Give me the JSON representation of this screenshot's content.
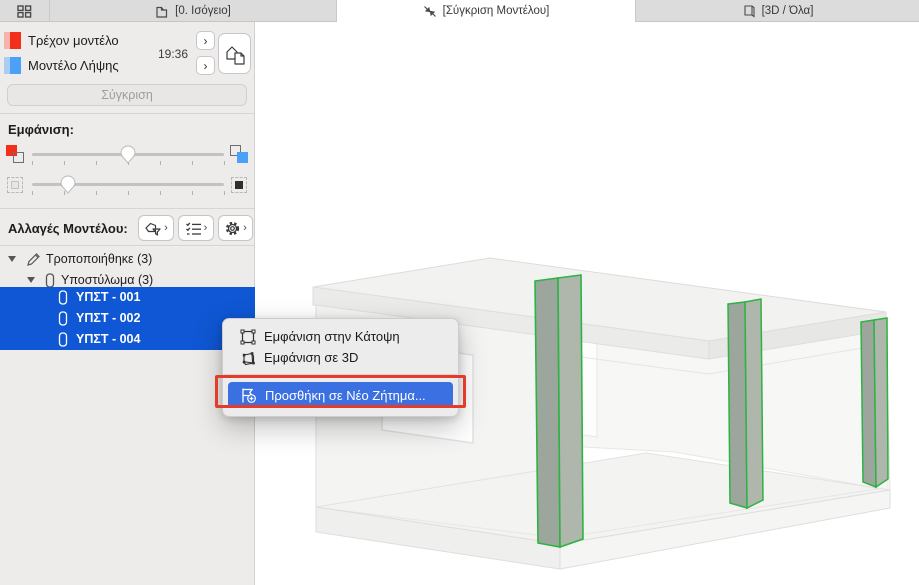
{
  "header": {
    "tabs": [
      {
        "label": "[0. Ισόγειο]",
        "icon": "floor-plan-icon",
        "active": false
      },
      {
        "label": "[Σύγκριση Μοντέλου]",
        "icon": "compare-arrows-icon",
        "active": true
      },
      {
        "label": "[3D / Όλα]",
        "icon": "cube-icon",
        "active": false
      }
    ]
  },
  "sidebar": {
    "models": [
      {
        "label": "Τρέχον μοντέλο",
        "color": "#f3301b",
        "color_light": "#f5b3ab"
      },
      {
        "label": "Μοντέλο Λήψης",
        "color": "#4ba1f7",
        "color_light": "#a9cdf3"
      }
    ],
    "timestamp": "19:36",
    "compare_button_label": "Σύγκριση",
    "display_section_label": "Εμφάνιση:",
    "sliders": [
      {
        "name": "model-color-intensity",
        "value_percent": 50
      },
      {
        "name": "unchanged-elements-visibility",
        "value_percent": 19
      }
    ],
    "changes_section_label": "Αλλαγές Μοντέλου:",
    "tool_buttons": [
      {
        "icon": "filter-model-icon"
      },
      {
        "icon": "checklist-icon"
      },
      {
        "icon": "gear-icon"
      }
    ],
    "tree": [
      {
        "label": "Τροποποιήθηκε (3)",
        "level": 0,
        "icon": "pencil-icon",
        "expanded": true,
        "selected": false
      },
      {
        "label": "Υποστύλωμα (3)",
        "level": 1,
        "icon": "column-icon",
        "expanded": true,
        "selected": false
      },
      {
        "label": "ΥΠΣΤ - 001",
        "level": 2,
        "icon": "column-icon",
        "selected": true
      },
      {
        "label": "ΥΠΣΤ - 002",
        "level": 2,
        "icon": "column-icon",
        "selected": true
      },
      {
        "label": "ΥΠΣΤ - 004",
        "level": 2,
        "icon": "column-icon",
        "selected": true
      }
    ]
  },
  "context_menu": {
    "items": [
      {
        "label": "Εμφάνιση στην Κάτοψη",
        "icon": "marquee-icon",
        "highlighted": false
      },
      {
        "label": "Εμφάνιση σε 3D",
        "icon": "cube-marquee-icon",
        "highlighted": false
      },
      {
        "label": "Προσθήκη σε Νέο Ζήτημα...",
        "icon": "issue-add-icon",
        "highlighted": true
      }
    ],
    "highlight_color": "#3b70e2",
    "annotation_color": "#e43b2a"
  },
  "canvas_3d": {
    "highlighted_column_count": 3,
    "highlight_color": "#2cb442",
    "selection_blue": "#0f57d4"
  },
  "ui": {
    "chevron": "›"
  }
}
